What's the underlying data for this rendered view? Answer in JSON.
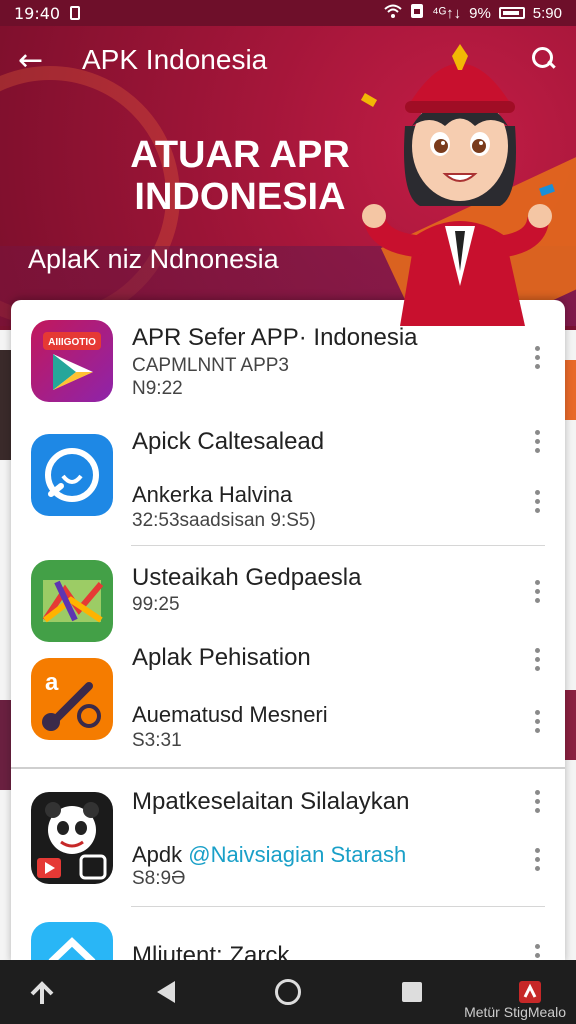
{
  "status_bar": {
    "time": "19:40",
    "signal": "⁴ᴳ↑↓",
    "battery_percent": "9%",
    "right_time": "5:90"
  },
  "app_bar": {
    "back_icon": "arrow-left-icon",
    "title": "APK Indonesia",
    "search_icon": "search-icon"
  },
  "hero": {
    "title_line1": "ATUAR APR",
    "title_line2": "INDONESIA",
    "subtitle": "AplaK niz Ndnonesia"
  },
  "list": [
    {
      "title": "APR Sefer APP· Indonesia",
      "subtitle": "CAPMLNNT APP3",
      "meta": "N9:22"
    },
    {
      "title": "Apick Caltesalead",
      "subtitle": "Ankerka Halvina",
      "meta": "32:53saadsisan 9:S5)"
    },
    {
      "title": "Usteaikah Gedpaesla",
      "meta": "99:25"
    },
    {
      "title": "Aplak Pehisation",
      "subtitle": "Auematusd Mesneri",
      "meta": "S3:31"
    },
    {
      "title": "Mpatkeselaitan Silalaykan",
      "subtitle_prefix": "Apdk",
      "subtitle_link": "@Naivsiagian Starash",
      "meta": "S8:9Ə"
    },
    {
      "title": "Mliutent: Zarck"
    }
  ],
  "icon_badge_text": "AIIIGOTIO",
  "icon_badge_letter": "a",
  "nav_bar": {
    "caption": "Metür StigMealo"
  },
  "colors": {
    "banner": "#a5163a",
    "accent_link": "#1aa0c8",
    "nav_bg": "#1e1e1e"
  }
}
